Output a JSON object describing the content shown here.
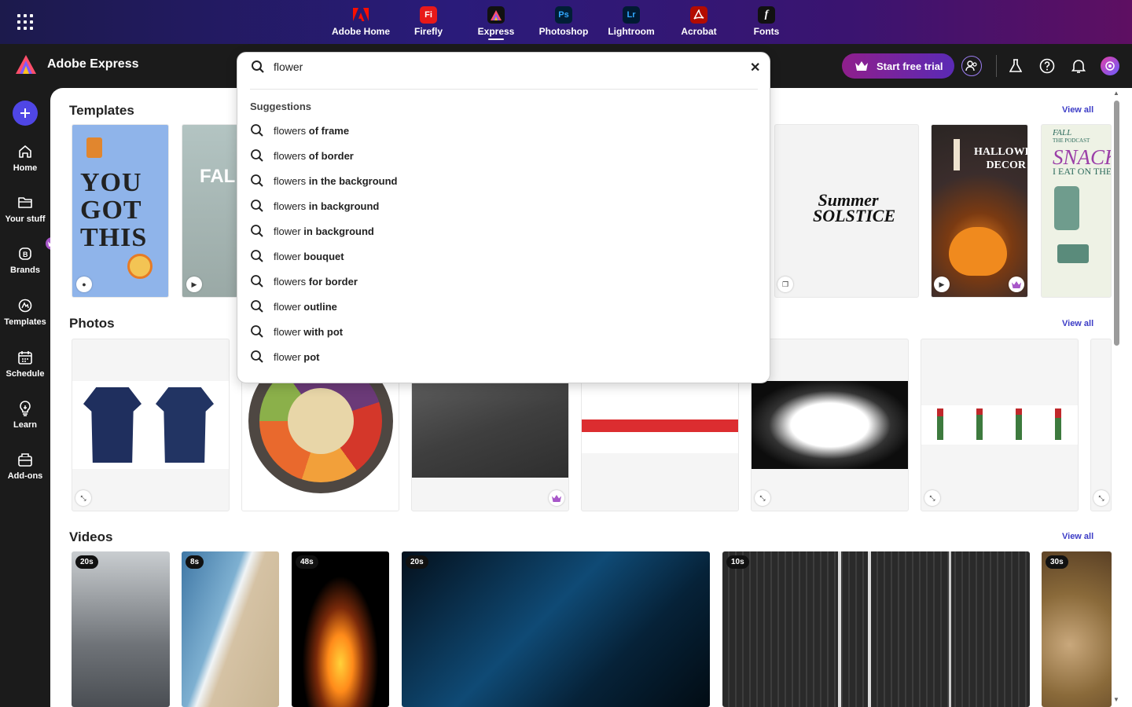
{
  "topbar": {
    "apps": [
      {
        "label": "Adobe Home",
        "icon": "adobe-logo-icon",
        "badge": "",
        "color": "#fa0f00"
      },
      {
        "label": "Firefly",
        "icon": "firefly-icon",
        "badge": "Fi",
        "color": "#e81919"
      },
      {
        "label": "Express",
        "icon": "express-icon",
        "badge": "",
        "color": "#111111"
      },
      {
        "label": "Photoshop",
        "icon": "photoshop-icon",
        "badge": "Ps",
        "color": "#001e36"
      },
      {
        "label": "Lightroom",
        "icon": "lightroom-icon",
        "badge": "Lr",
        "color": "#001a33"
      },
      {
        "label": "Acrobat",
        "icon": "acrobat-icon",
        "badge": "",
        "color": "#b30b00"
      },
      {
        "label": "Fonts",
        "icon": "fonts-icon",
        "badge": "f",
        "color": "#111111"
      }
    ],
    "active_app": "Express"
  },
  "header": {
    "brand": "Adobe Express",
    "trial_label": "Start free trial"
  },
  "sidebar": {
    "items": [
      {
        "label": "Home",
        "icon": "home-icon"
      },
      {
        "label": "Your stuff",
        "icon": "folder-icon"
      },
      {
        "label": "Brands",
        "icon": "brands-icon"
      },
      {
        "label": "Templates",
        "icon": "templates-icon"
      },
      {
        "label": "Schedule",
        "icon": "calendar-icon"
      },
      {
        "label": "Learn",
        "icon": "lightbulb-icon"
      },
      {
        "label": "Add-ons",
        "icon": "addons-icon"
      }
    ]
  },
  "sections": {
    "templates": {
      "title": "Templates",
      "view_all": "View all"
    },
    "photos": {
      "title": "Photos",
      "view_all": "View all"
    },
    "videos": {
      "title": "Videos",
      "view_all": "View all"
    }
  },
  "template_cards": [
    {
      "text": [
        "YOU",
        "GOT",
        "THIS"
      ]
    },
    {
      "text": "FAL"
    },
    {
      "text": "Summer SOLSTICE"
    },
    {
      "text": "HALLOWEEN DECOR"
    },
    {
      "text": "SNACK"
    },
    {
      "text": "I EAT ON THE R"
    },
    {
      "text": "FALL"
    },
    {
      "text": "THE PODCAST"
    }
  ],
  "video_durations": [
    "20s",
    "8s",
    "48s",
    "20s",
    "10s",
    "30s"
  ],
  "search": {
    "query": "flower",
    "suggestions_label": "Suggestions",
    "suggestions": [
      {
        "q": "flowers",
        "rest": " of frame"
      },
      {
        "q": "flowers",
        "rest": " of border"
      },
      {
        "q": "flowers",
        "rest": " in the background"
      },
      {
        "q": "flowers",
        "rest": " in background"
      },
      {
        "q": "flower",
        "rest": " in background"
      },
      {
        "q": "flower",
        "rest": " bouquet"
      },
      {
        "q": "flowers",
        "rest": " for border"
      },
      {
        "q": "flower",
        "rest": " outline"
      },
      {
        "q": "flower",
        "rest": " with pot"
      },
      {
        "q": "flower",
        "rest": " pot"
      }
    ]
  },
  "colors": {
    "accent": "#4f46e5",
    "trial_start": "#8f1f8c",
    "trial_end": "#5a2ab5",
    "link": "#3c3cc6"
  }
}
